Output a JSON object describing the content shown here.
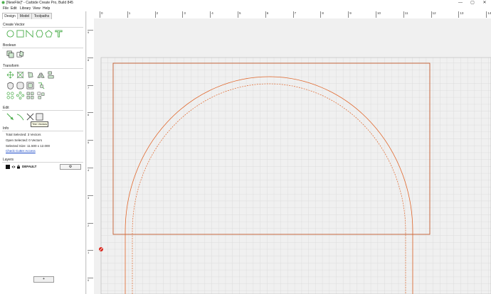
{
  "window": {
    "title": "[NewFile]* - Carbide Create Pro, Build 845",
    "minimize_glyph": "—",
    "maximize_glyph": "▢",
    "close_glyph": "✕"
  },
  "menu": [
    "File",
    "Edit",
    "Library",
    "View",
    "Help"
  ],
  "tabs": [
    {
      "label": "Design",
      "active": true
    },
    {
      "label": "Model",
      "active": false
    },
    {
      "label": "Toolpaths",
      "active": false
    }
  ],
  "sections": {
    "create_vector": "Create Vector",
    "boolean": "Boolean",
    "transform": "Transform",
    "edit": "Edit",
    "info": "Info",
    "layers": "Layers"
  },
  "create_vector_tools": [
    "circle-icon",
    "rectangle-icon",
    "polyline-icon",
    "polygon-icon",
    "pentagon-icon",
    "text-icon"
  ],
  "boolean_tools": [
    "union-icon",
    "subtract-icon"
  ],
  "transform_tools": [
    "move-icon",
    "scale-icon",
    "rotate-icon",
    "mirror-icon",
    "align-icon",
    "offset-icon",
    "rounded-rect-icon",
    "fillet-icon",
    "path-icon",
    "array-icon",
    "distribute-icon",
    "group-icon",
    "ungroup-icon"
  ],
  "edit_tools": [
    "node-edit-icon",
    "pen-icon",
    "trim-icon",
    "join-icon"
  ],
  "tooltip": "Trim Vectors",
  "info": {
    "total_selected": "Total Selected:   3 Vectors",
    "open_selected": "Open Selected:   0 Vectors",
    "selected_size": "Selected Size:     11.500 x 12.000",
    "check_cutter_access": "Check Cutter Access"
  },
  "layers": {
    "name": "DEFAULT",
    "gear_glyph": "⚙",
    "add_label": "+"
  },
  "ruler": {
    "top_ticks": [
      "0",
      "1",
      "2",
      "3",
      "4",
      "5",
      "6",
      "7",
      "8",
      "9",
      "10",
      "11",
      "12",
      "13",
      "14"
    ],
    "left_ticks": [
      "9",
      "8",
      "7",
      "6",
      "5",
      "4",
      "3",
      "2",
      "1",
      "0"
    ]
  },
  "colors": {
    "accent_green": "#4cae4c",
    "vector_orange": "#e0662a",
    "grid": "#d9d9d9",
    "stock_border": "#c15a2c"
  }
}
